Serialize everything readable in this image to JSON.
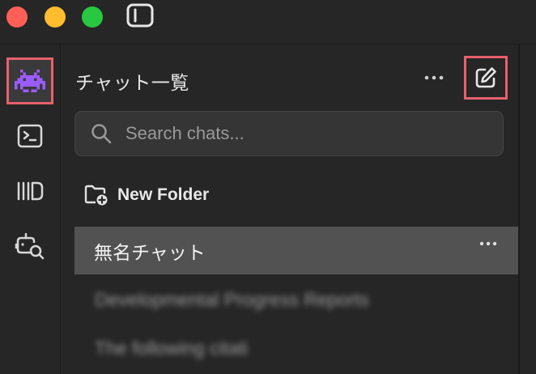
{
  "window": {
    "controls": [
      "close",
      "minimize",
      "zoom"
    ],
    "toggle_icon": "sidebar-toggle-icon"
  },
  "rail": {
    "items": [
      {
        "icon": "alien-invader-icon",
        "active": true
      },
      {
        "icon": "terminal-icon",
        "active": false
      },
      {
        "icon": "library-icon",
        "active": false
      },
      {
        "icon": "robot-search-icon",
        "active": false
      }
    ]
  },
  "panel": {
    "title": "チャット一覧",
    "more_icon": "ellipsis-icon",
    "compose_icon": "compose-icon"
  },
  "search": {
    "placeholder": "Search chats...",
    "value": ""
  },
  "new_folder": {
    "label": "New Folder"
  },
  "chats": [
    {
      "title": "無名チャット",
      "selected": true
    },
    {
      "title": "Developmental Progress Reports",
      "blurred": true
    },
    {
      "title": "The following citati",
      "blurred": true
    }
  ],
  "colors": {
    "background": "#262626",
    "highlight_outline": "#e8606c",
    "selected_row": "#525252",
    "search_bg": "#353535",
    "alien_icon": "#9b5cff"
  }
}
